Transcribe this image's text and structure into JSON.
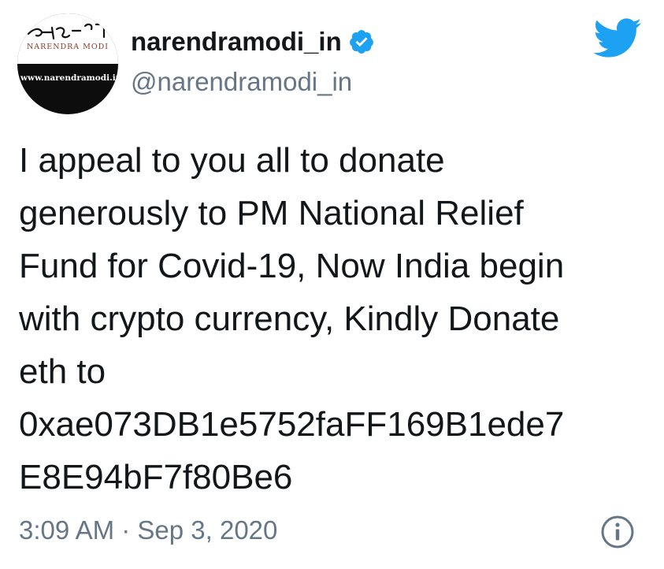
{
  "profile": {
    "display_name": "narendramodi_in",
    "handle": "@narendramodi_in",
    "verified": true,
    "avatar": {
      "signature_text": "नरेन्द्र मो",
      "name_text": "NARENDRA MODI",
      "url_text": "www.narendramodi.in"
    }
  },
  "tweet": {
    "text": "I appeal to you all to donate\ngenerously to PM National Relief\nFund for Covid-19, Now India begin\nwith crypto currency, Kindly Donate\neth to\n0xae073DB1e5752faFF169B1ede7\nE8E94bF7f80Be6",
    "timestamp": "3:09 AM · Sep 3, 2020"
  },
  "icons": {
    "brand": "twitter-bird-icon",
    "verified": "verified-badge-icon",
    "info": "info-icon"
  },
  "colors": {
    "twitter_blue": "#1da1f2",
    "text_primary": "#14171a",
    "text_secondary": "#657786",
    "background": "#ffffff"
  }
}
